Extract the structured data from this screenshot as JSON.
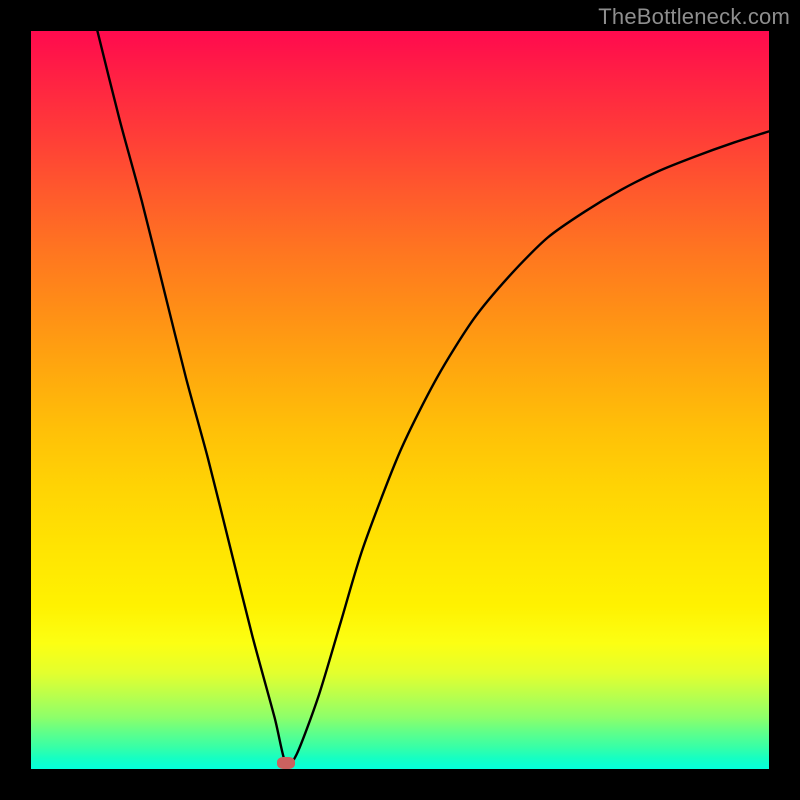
{
  "watermark": "TheBottleneck.com",
  "colors": {
    "background": "#000000",
    "gradient_top": "#ff0a4e",
    "gradient_bottom": "#04ffdc",
    "curve": "#000000",
    "marker": "#cb615f",
    "watermark_text": "#8e8e8e"
  },
  "chart_data": {
    "type": "line",
    "title": "",
    "xlabel": "",
    "ylabel": "",
    "xlim": [
      0,
      100
    ],
    "ylim": [
      0,
      100
    ],
    "grid": false,
    "series": [
      {
        "name": "bottleneck-curve",
        "x": [
          9,
          12,
          15,
          18,
          21,
          24,
          27,
          30,
          33,
          34.5,
          36,
          39,
          42,
          45,
          50,
          55,
          60,
          65,
          70,
          75,
          80,
          85,
          90,
          95,
          100
        ],
        "y": [
          100,
          88,
          77,
          65,
          53,
          42,
          30,
          18,
          7,
          0.8,
          2,
          10,
          20,
          30,
          43,
          53,
          61,
          67,
          72,
          75.5,
          78.5,
          81,
          83,
          84.8,
          86.4
        ]
      }
    ],
    "annotations": [
      {
        "name": "minimum-marker",
        "x": 34.5,
        "y": 0.8
      }
    ]
  }
}
